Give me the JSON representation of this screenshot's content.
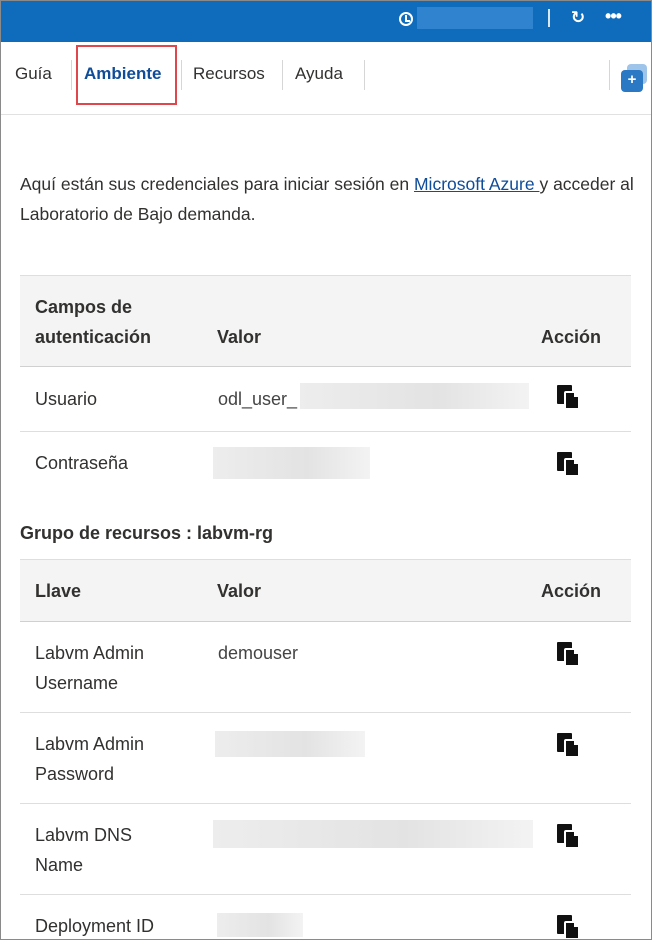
{
  "topbar": {
    "timer_icon": "clock-icon",
    "refresh_icon": "refresh-icon",
    "more_icon": "more-icon"
  },
  "tabs": [
    {
      "label": "Guía"
    },
    {
      "label": "Ambiente",
      "active": true
    },
    {
      "label": "Recursos"
    },
    {
      "label": "Ayuda"
    }
  ],
  "intro": {
    "text_before": "Aquí están sus credenciales para iniciar sesión en ",
    "link": "Microsoft Azure ",
    "text_after": "y acceder al Laboratorio de Bajo demanda."
  },
  "auth_table": {
    "headers": {
      "field": "Campos de autenticación",
      "value": "Valor",
      "action": "Acción"
    },
    "rows": [
      {
        "field": "Usuario",
        "value": "odl_user_"
      },
      {
        "field": "Contraseña",
        "value": ""
      }
    ]
  },
  "resource_group": {
    "title": "Grupo de recursos : labvm-rg"
  },
  "resource_table": {
    "headers": {
      "key": "Llave",
      "value": "Valor",
      "action": "Acción"
    },
    "rows": [
      {
        "key": "Labvm Admin Username",
        "value": "demouser"
      },
      {
        "key": "Labvm Admin Password",
        "value": ""
      },
      {
        "key": "Labvm DNS Name",
        "value": ""
      },
      {
        "key": "Deployment ID",
        "value": ""
      }
    ]
  },
  "colors": {
    "topbar": "#0f6cbd",
    "active_tab": "#0f4c99",
    "highlight": "#e0474c"
  }
}
